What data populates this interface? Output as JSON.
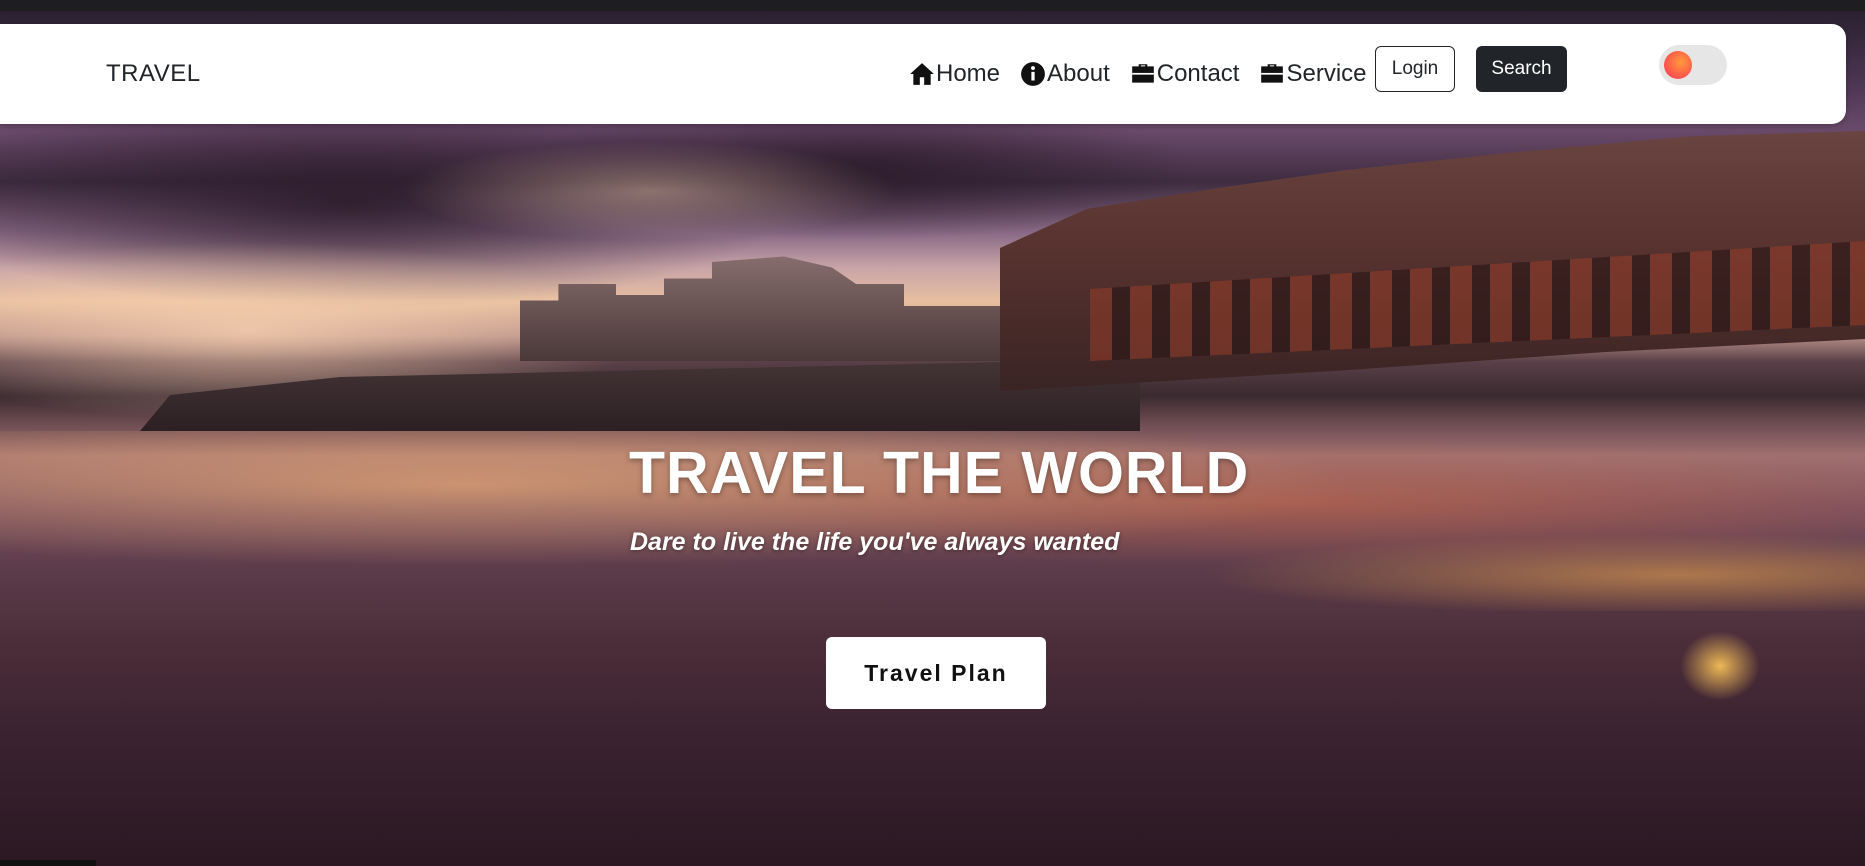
{
  "navbar": {
    "brand": "TRAVEL",
    "links": [
      {
        "label": "Home",
        "icon": "home-icon"
      },
      {
        "label": "About",
        "icon": "info-icon"
      },
      {
        "label": "Contact",
        "icon": "briefcase-icon"
      },
      {
        "label": "Service",
        "icon": "briefcase-icon"
      }
    ],
    "login_label": "Login",
    "search_label": "Search",
    "theme_toggle": {
      "state": "off",
      "knob_colors": [
        "#ff9a3c",
        "#ff2d6a"
      ]
    }
  },
  "hero": {
    "title": "TRAVEL THE WORLD",
    "subtitle": "Dare to live the life you've always wanted",
    "cta_label": "Travel Plan"
  },
  "colors": {
    "navbar_bg": "#ffffff",
    "text_dark": "#212529",
    "search_bg": "#212529",
    "hero_text": "#ffffff"
  }
}
